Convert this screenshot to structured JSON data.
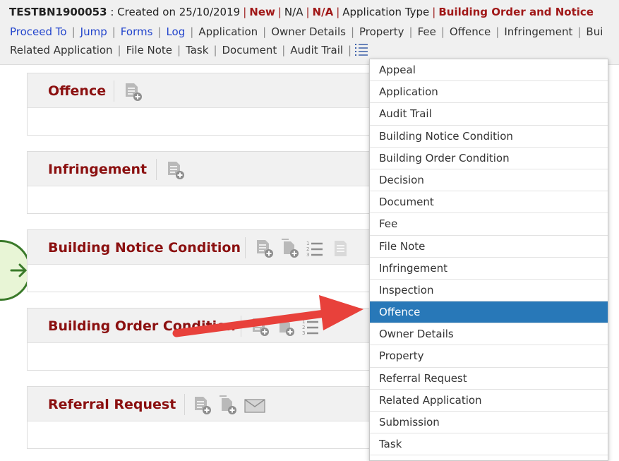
{
  "header": {
    "ref": "TESTBN1900053",
    "created": " : Created on 25/10/2019",
    "status_new": "New",
    "na1": "N/A",
    "na2": "N/A",
    "app_type_label": "Application Type",
    "app_type_value": "Building Order and Notice"
  },
  "nav": {
    "row1": [
      {
        "label": "Proceed To",
        "link": true
      },
      {
        "label": "Jump",
        "link": true
      },
      {
        "label": "Forms",
        "link": true
      },
      {
        "label": "Log",
        "link": true
      },
      {
        "label": "Application",
        "link": false
      },
      {
        "label": "Owner Details",
        "link": false
      },
      {
        "label": "Property",
        "link": false
      },
      {
        "label": "Fee",
        "link": false
      },
      {
        "label": "Offence",
        "link": false
      },
      {
        "label": "Infringement",
        "link": false
      },
      {
        "label": "Bui",
        "link": false
      }
    ],
    "row2": [
      {
        "label": "Related Application"
      },
      {
        "label": "File Note"
      },
      {
        "label": "Task"
      },
      {
        "label": "Document"
      },
      {
        "label": "Audit Trail"
      }
    ]
  },
  "sections": [
    {
      "title": "Offence"
    },
    {
      "title": "Infringement"
    },
    {
      "title": "Building Notice Condition"
    },
    {
      "title": "Building Order Condition"
    },
    {
      "title": "Referral Request"
    }
  ],
  "dropdown": {
    "items": [
      "Appeal",
      "Application",
      "Audit Trail",
      "Building Notice Condition",
      "Building Order Condition",
      "Decision",
      "Document",
      "Fee",
      "File Note",
      "Infringement",
      "Inspection",
      "Offence",
      "Owner Details",
      "Property",
      "Referral Request",
      "Related Application",
      "Submission",
      "Task"
    ],
    "selected_index": 11
  },
  "colors": {
    "accent_red": "#8b1010",
    "link_blue": "#2244cc",
    "selected_blue": "#2878b8",
    "annotation_arrow": "#e8413b"
  }
}
